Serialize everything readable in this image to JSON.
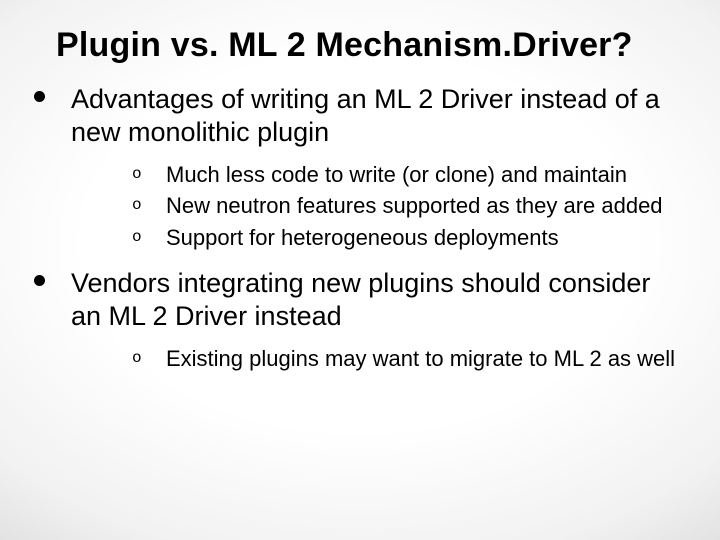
{
  "title": "Plugin vs. ML 2 Mechanism.Driver?",
  "bullets": [
    {
      "lead": "Advantages of writing an ML 2 Driver instead of a new monolithic plugin",
      "subs": [
        "Much less code to write (or clone) and maintain",
        "New neutron features supported as they are added",
        "Support for heterogeneous deployments"
      ]
    },
    {
      "lead": "Vendors integrating new plugins should consider an ML 2 Driver instead",
      "subs": [
        "Existing plugins may want to migrate to ML 2 as well"
      ]
    }
  ],
  "marker": "o"
}
